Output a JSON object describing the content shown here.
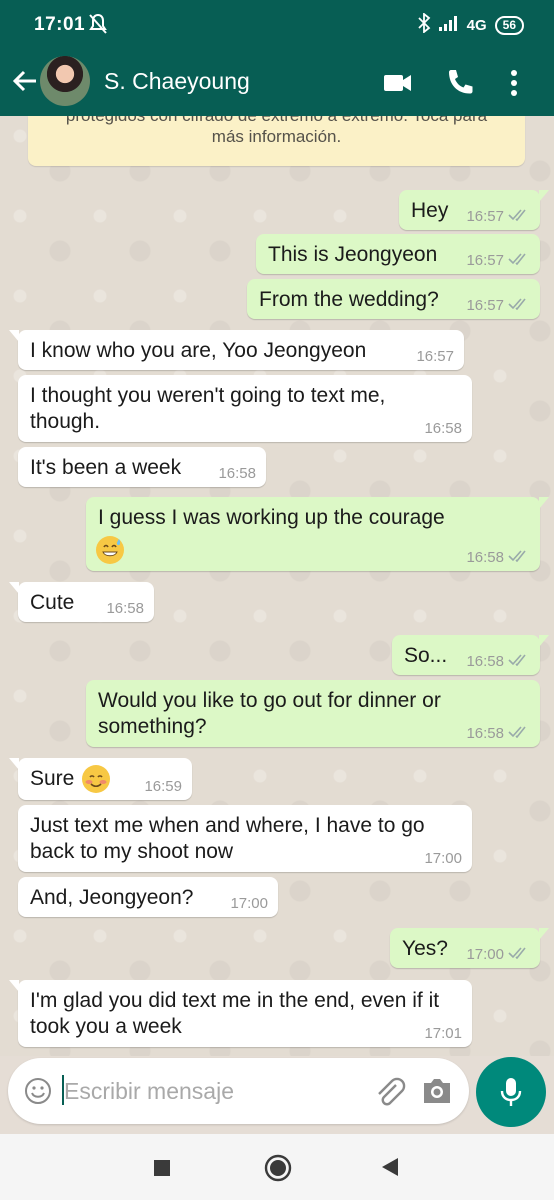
{
  "status_bar": {
    "time": "17:01",
    "network": "4G",
    "battery": "56"
  },
  "header": {
    "contact_name": "S. Chaeyoung"
  },
  "encryption_notice": "protegidos con cifrado de extremo a extremo. Toca para\nmás información.",
  "messages": [
    {
      "dir": "out",
      "text": "Hey",
      "time": "16:57"
    },
    {
      "dir": "out",
      "text": "This is Jeongyeon",
      "time": "16:57"
    },
    {
      "dir": "out",
      "text": "From the wedding?",
      "time": "16:57"
    },
    {
      "dir": "in",
      "text": "I know who you are, Yoo Jeongyeon",
      "time": "16:57"
    },
    {
      "dir": "in",
      "text": "I thought you weren't going to text me,\nthough.",
      "time": "16:58"
    },
    {
      "dir": "in",
      "text": "It's been a week",
      "time": "16:58"
    },
    {
      "dir": "out",
      "text": "I guess I was working up the courage",
      "time": "16:58",
      "emoji": "grinning-sweat-emoji"
    },
    {
      "dir": "in",
      "text": "Cute",
      "time": "16:58"
    },
    {
      "dir": "out",
      "text": "So...",
      "time": "16:58"
    },
    {
      "dir": "out",
      "text": "Would you like to go out for dinner or\nsomething?",
      "time": "16:58"
    },
    {
      "dir": "in",
      "text": "Sure",
      "time": "16:59",
      "emoji": "smiling-blush-emoji"
    },
    {
      "dir": "in",
      "text": "Just text me when and where, I have to go\nback to my shoot now",
      "time": "17:00"
    },
    {
      "dir": "in",
      "text": "And, Jeongyeon?",
      "time": "17:00"
    },
    {
      "dir": "out",
      "text": "Yes?",
      "time": "17:00"
    },
    {
      "dir": "in",
      "text": "I'm glad you did text me in the end, even if it\ntook you a week",
      "time": "17:01"
    }
  ],
  "input": {
    "placeholder": "Escribir mensaje"
  },
  "colors": {
    "header": "#075e54",
    "outgoing_bubble": "#dcf8c6",
    "incoming_bubble": "#ffffff",
    "fab": "#00897b",
    "notice": "#fbf1c7"
  }
}
